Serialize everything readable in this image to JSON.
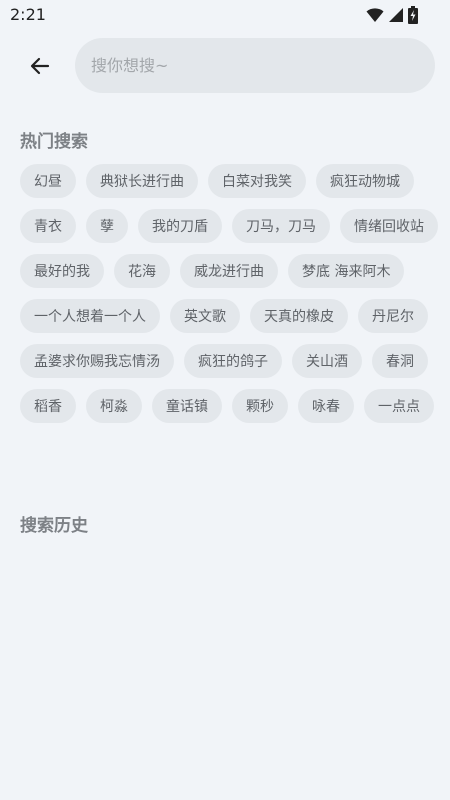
{
  "status_bar": {
    "time": "2:21",
    "icons": [
      "wifi-icon",
      "signal-icon",
      "battery-charging-icon"
    ]
  },
  "search": {
    "back_icon": "arrow-left-icon",
    "placeholder": "搜你想搜~",
    "value": ""
  },
  "hot_search": {
    "title": "热门搜索",
    "tags": [
      "幻昼",
      "典狱长进行曲",
      "白菜对我笑",
      "疯狂动物城",
      "青衣",
      "孽",
      "我的刀盾",
      "刀马，刀马",
      "情绪回收站",
      "最好的我",
      "花海",
      "威龙进行曲",
      "梦底 海来阿木",
      "一个人想着一个人",
      "英文歌",
      "天真的橡皮",
      "丹尼尔",
      "孟婆求你赐我忘情汤",
      "疯狂的鸽子",
      "关山酒",
      "春洞",
      "稻香",
      "柯淼",
      "童话镇",
      "颗秒",
      "咏春",
      "一点点"
    ]
  },
  "history": {
    "title": "搜索历史",
    "items": []
  },
  "colors": {
    "background": "#f1f4f8",
    "tag_background": "#e3e7eb",
    "tag_text": "#5f6368",
    "section_title": "#7d8186"
  }
}
